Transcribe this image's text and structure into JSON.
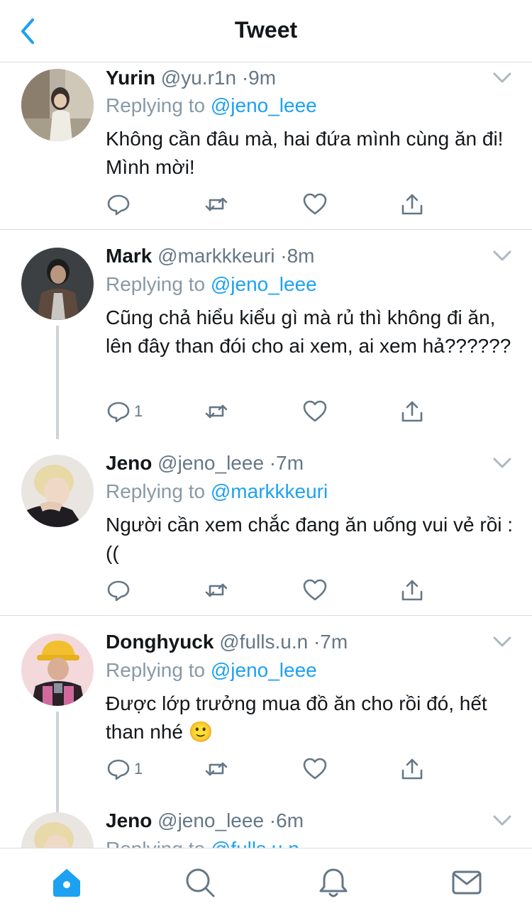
{
  "header": {
    "title": "Tweet"
  },
  "tweets": [
    {
      "name": "Yurin",
      "handle": "@yu.r1n",
      "time": "9m",
      "replying_prefix": "Replying to",
      "replying_to": "@jeno_leee",
      "text": "Không cần đâu mà, hai đứa mình cùng ăn đi! Mình mời!",
      "reply_count": ""
    },
    {
      "name": "Mark",
      "handle": "@markkkeuri",
      "time": "8m",
      "replying_prefix": "Replying to",
      "replying_to": "@jeno_leee",
      "text": "Cũng chả hiểu kiểu gì mà rủ thì không đi ăn, lên đây than đói cho ai xem, ai xem hả??????",
      "reply_count": "1"
    },
    {
      "name": "Jeno",
      "handle": "@jeno_leee",
      "time": "7m",
      "replying_prefix": "Replying to",
      "replying_to": "@markkkeuri",
      "text": "Người cần xem chắc đang ăn uống vui vẻ rồi :((",
      "reply_count": ""
    },
    {
      "name": "Donghyuck",
      "handle": "@fulls.u.n",
      "time": "7m",
      "replying_prefix": "Replying to",
      "replying_to": "@jeno_leee",
      "text": "Được lớp trưởng mua đồ ăn cho rồi đó, hết than nhé 🙂",
      "reply_count": "1"
    },
    {
      "name": "Jeno",
      "handle": "@jeno_leee",
      "time": "6m",
      "replying_prefix": "Replying to",
      "replying_to": "@fulls.u.n",
      "text": "",
      "reply_count": ""
    }
  ],
  "tabbar": {
    "items": [
      {
        "icon": "home-icon",
        "active": true
      },
      {
        "icon": "search-icon",
        "active": false
      },
      {
        "icon": "bell-icon",
        "active": false
      },
      {
        "icon": "mail-icon",
        "active": false
      }
    ]
  },
  "colors": {
    "accent": "#1da1f2",
    "icon_gray": "#657786",
    "divider": "#d8dde2",
    "thread_line": "#cdd3d9"
  }
}
